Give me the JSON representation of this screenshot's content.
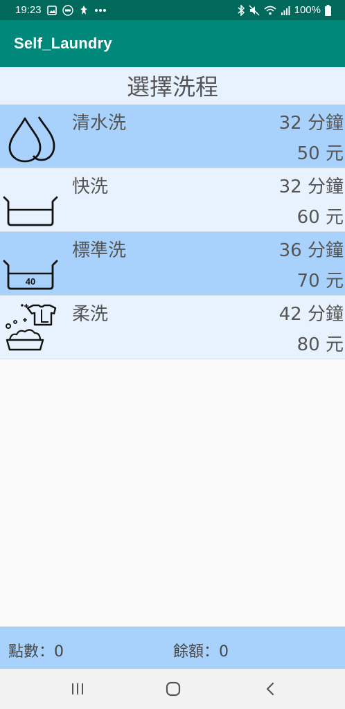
{
  "status": {
    "time": "19:23",
    "battery": "100%"
  },
  "app": {
    "title": "Self_Laundry"
  },
  "header": {
    "title": "選擇洗程"
  },
  "programs": [
    {
      "name": "清水洗",
      "time": "32 分鐘",
      "price": "50 元",
      "icon": "water-drops-icon"
    },
    {
      "name": "快洗",
      "time": "32 分鐘",
      "price": "60 元",
      "icon": "wash-basin-icon"
    },
    {
      "name": "標準洗",
      "time": "36 分鐘",
      "price": "70 元",
      "icon": "wash-40-icon",
      "icon_text": "40"
    },
    {
      "name": "柔洗",
      "time": "42 分鐘",
      "price": "80 元",
      "icon": "gentle-wash-icon"
    }
  ],
  "footer": {
    "points": "點數：0",
    "balance": "餘額：0"
  },
  "colors": {
    "status_bar": "#00695c",
    "app_bar": "#00897b",
    "row_dark": "#a8d2fb",
    "row_light": "#e8f2fe"
  }
}
